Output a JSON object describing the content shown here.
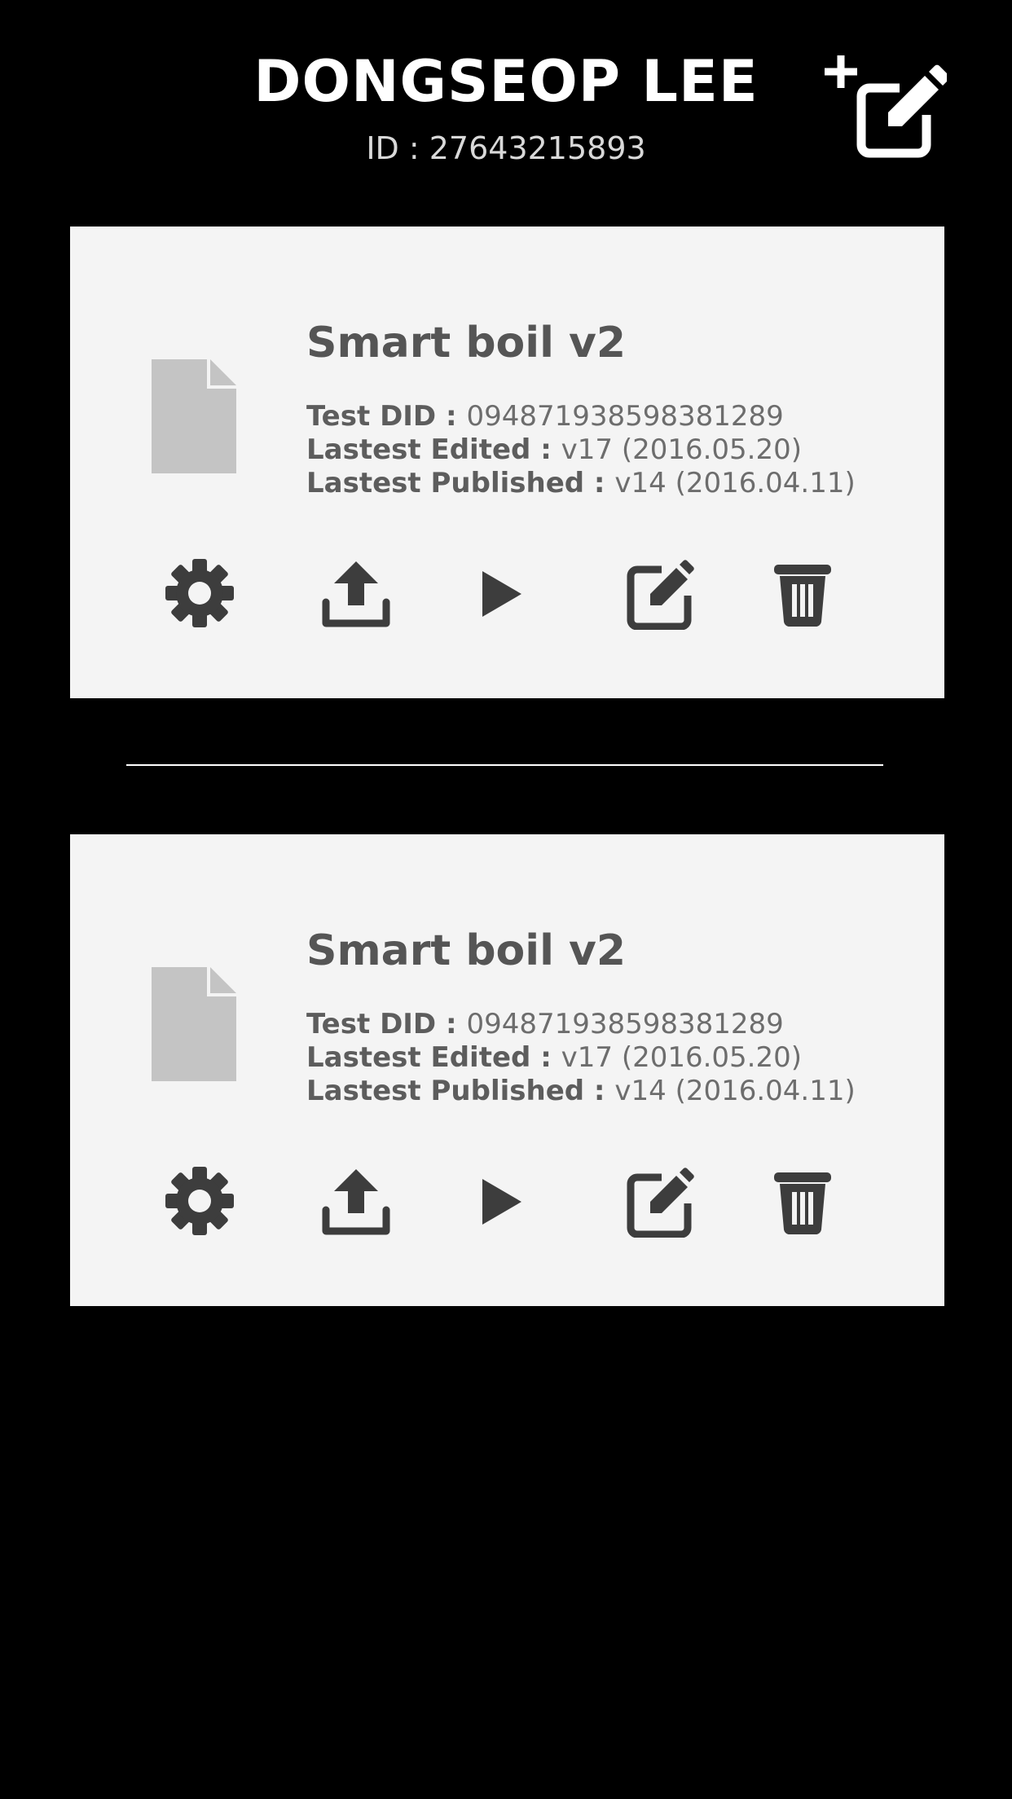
{
  "header": {
    "user_name": "DONGSEOP LEE",
    "user_id": "ID : 27643215893",
    "add_button_icon": "add-edit-icon"
  },
  "projects": [
    {
      "title": "Smart boil v2",
      "test_did_label": "Test DID : ",
      "test_did_value": "094871938598381289",
      "edited_label": "Lastest Edited : ",
      "edited_value": "v17 (2016.05.20)",
      "published_label": "Lastest Published : ",
      "published_value": "v14 (2016.04.11)",
      "actions": [
        "settings-icon",
        "upload-icon",
        "play-icon",
        "edit-icon",
        "delete-icon"
      ]
    },
    {
      "title": "Smart boil v2",
      "test_did_label": "Test DID : ",
      "test_did_value": "094871938598381289",
      "edited_label": "Lastest Edited : ",
      "edited_value": "v17 (2016.05.20)",
      "published_label": "Lastest Published : ",
      "published_value": "v14 (2016.04.11)",
      "actions": [
        "settings-icon",
        "upload-icon",
        "play-icon",
        "edit-icon",
        "delete-icon"
      ]
    }
  ],
  "colors": {
    "background": "#000000",
    "card": "#f4f4f4",
    "icon_dark": "#3d3d3d",
    "file_icon": "#c4c4c4",
    "header_text": "#ffffff"
  }
}
